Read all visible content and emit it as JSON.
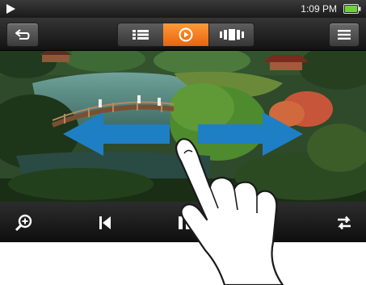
{
  "status_bar": {
    "play_indicator_icon": "play-icon",
    "time": "1:09 PM",
    "battery_icon": "battery-icon"
  },
  "toolbar": {
    "back_icon": "back-arrow-icon",
    "view_modes": [
      {
        "icon": "list-icon",
        "selected": false
      },
      {
        "icon": "play-circle-icon",
        "selected": true
      },
      {
        "icon": "filmstrip-icon",
        "selected": false
      }
    ],
    "menu_icon": "menu-icon"
  },
  "photo": {
    "subject": "japanese-garden-bridge-photo",
    "gesture_arrows": [
      "swipe-left-arrow",
      "swipe-right-arrow"
    ]
  },
  "controls": {
    "icons": [
      "zoom-icon",
      "previous-icon",
      "pause-icon",
      "rotate-icon"
    ]
  },
  "colors": {
    "accent": "#f07a1a",
    "arrow": "#1f7fc4",
    "bar": "#1c1c1c"
  }
}
